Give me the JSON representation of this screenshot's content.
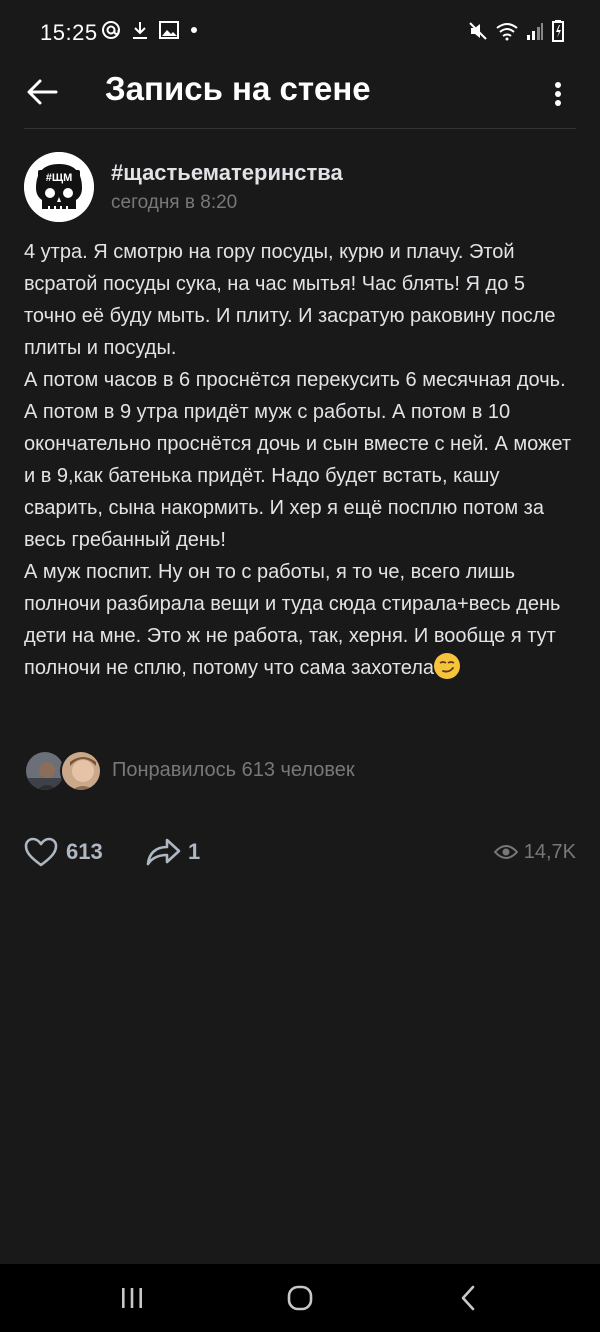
{
  "status_bar": {
    "time": "15:25",
    "left_icons": [
      "at-icon",
      "download-icon",
      "image-icon",
      "dot-icon"
    ],
    "right_icons": [
      "mute-icon",
      "wifi-icon",
      "signal-icon",
      "battery-icon"
    ]
  },
  "header": {
    "title": "Запись на стене",
    "back_icon": "arrow-left-icon",
    "more_icon": "more-vertical-icon"
  },
  "post": {
    "author": "#щастьематеринства",
    "avatar_text": "#ЩМ",
    "date": "сегодня в 8:20",
    "text": "4 утра. Я смотрю на гору посуды, курю и плачу. Этой всратой посуды сука, на час мытья! Час блять! Я до 5 точно её буду мыть. И плиту. И засратую раковину после плиты и посуды.\nА потом часов в 6 проснётся перекусить 6 месячная дочь. А потом в 9 утра придёт муж с работы. А потом в 10 окончательно проснётся дочь и сын вместе с ней. А может и в 9,как батенька придёт. Надо будет встать, кашу сварить, сына накормить. И хер я ещё посплю потом за весь гребанный день!\nА муж поспит. Ну он то с работы, я то че, всего лишь полночи разбирала вещи и туда сюда стирала+весь день дети на мне. Это ж не работа, так, херня. И вообще я тут полночи не сплю, потому что сама захотела",
    "emoji": "smirking-face-emoji",
    "likes_text": "Понравилось 613 человек",
    "like_count": "613",
    "share_count": "1",
    "views": "14,7K"
  },
  "nav": {
    "recents_icon": "recents-icon",
    "home_icon": "home-icon",
    "back_icon": "back-chevron-icon"
  },
  "colors": {
    "background": "#191919",
    "text": "#e1e3e6",
    "secondary": "#76787a",
    "action": "#aeb7c2"
  }
}
